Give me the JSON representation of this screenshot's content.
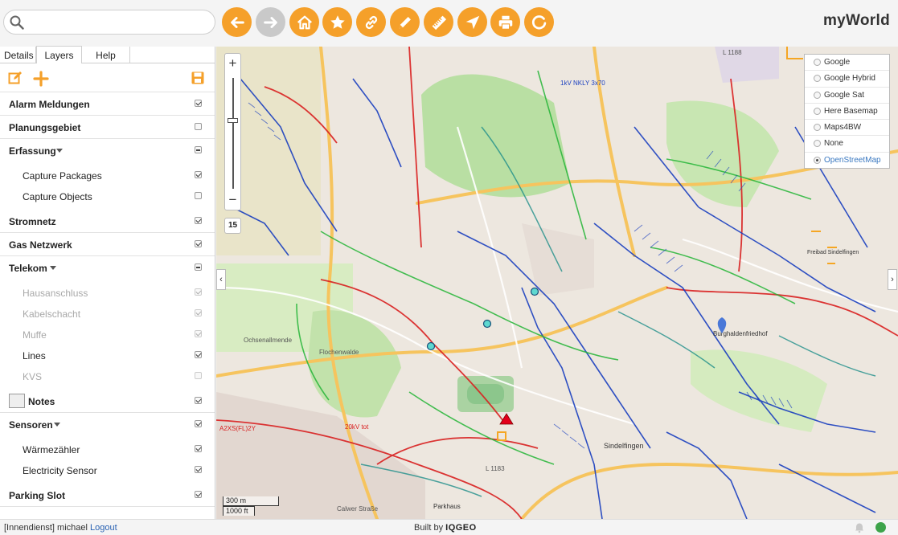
{
  "brand": "myWorld",
  "search": {
    "value": "",
    "placeholder": ""
  },
  "toolbar": {
    "buttons": [
      {
        "icon": "arrow-left-icon",
        "enabled": true
      },
      {
        "icon": "arrow-right-icon",
        "enabled": false
      },
      {
        "icon": "home-icon",
        "enabled": true
      },
      {
        "icon": "star-icon",
        "enabled": true
      },
      {
        "icon": "link-icon",
        "enabled": true
      },
      {
        "icon": "pencil-icon",
        "enabled": true
      },
      {
        "icon": "ruler-icon",
        "enabled": true
      },
      {
        "icon": "locate-arrow-icon",
        "enabled": true
      },
      {
        "icon": "print-icon",
        "enabled": true
      },
      {
        "icon": "refresh-icon",
        "enabled": true
      }
    ],
    "accent_color": "#F5A02A"
  },
  "tabs": {
    "details": "Details",
    "layers": "Layers",
    "help": "Help",
    "active": "Layers"
  },
  "layers": [
    {
      "label": "Alarm Meldungen",
      "checked": true
    },
    {
      "label": "Planungsgebiet",
      "checked": false
    },
    {
      "label": "Erfassung",
      "state": "mixed",
      "expanded": true,
      "children": [
        {
          "label": "Capture Packages",
          "checked": true
        },
        {
          "label": "Capture Objects",
          "checked": false
        }
      ]
    },
    {
      "label": "Stromnetz",
      "checked": true
    },
    {
      "label": "Gas Netzwerk",
      "checked": true
    },
    {
      "label": "Telekom",
      "state": "mixed",
      "expanded": true,
      "children": [
        {
          "label": "Hausanschluss",
          "checked": true,
          "disabled": true
        },
        {
          "label": "Kabelschacht",
          "checked": true,
          "disabled": true
        },
        {
          "label": "Muffe",
          "checked": true,
          "disabled": true
        },
        {
          "label": "Lines",
          "checked": true,
          "disabled": false
        },
        {
          "label": "KVS",
          "checked": false,
          "disabled": true
        }
      ]
    },
    {
      "label": "Notes",
      "checked": true
    },
    {
      "label": "Sensoren",
      "checked": true,
      "expanded": true,
      "children": [
        {
          "label": "Wärmezähler",
          "checked": true
        },
        {
          "label": "Electricity Sensor",
          "checked": true
        }
      ]
    },
    {
      "label": "Parking Slot",
      "checked": true
    }
  ],
  "map": {
    "zoom_level": "15",
    "zoom_in": "+",
    "zoom_out": "−",
    "basemaps": [
      "Google",
      "Google Hybrid",
      "Google Sat",
      "Here Basemap",
      "Maps4BW",
      "None",
      "OpenStreetMap"
    ],
    "selected_basemap": "OpenStreetMap",
    "scale_metric": "300 m",
    "scale_imperial": "1000 ft",
    "labels": {
      "road_l1183": "L 1183",
      "road_l1188": "L 1188",
      "place_burghalden": "Burghaldenfriedhof",
      "place_ochsenallmende": "Ochsenallmende",
      "place_flachenwalde": "Flochenwalde",
      "street_calwer": "Calwer Straße",
      "place_sindelfingen": "Sindelfingen",
      "place_parkhaus": "Parkhaus",
      "place_freibad": "Freibad Sindelfingen",
      "cable_1kv_nkly": "1kV NKLY 3x70",
      "cable_20kv": "20kV tot",
      "cable_a2xs": "A2XS(FL)2Y"
    }
  },
  "footer": {
    "user_prefix": "[Innendienst] michael",
    "logout": "Logout",
    "built_by": "Built by",
    "built_brand": "IQGEO"
  }
}
